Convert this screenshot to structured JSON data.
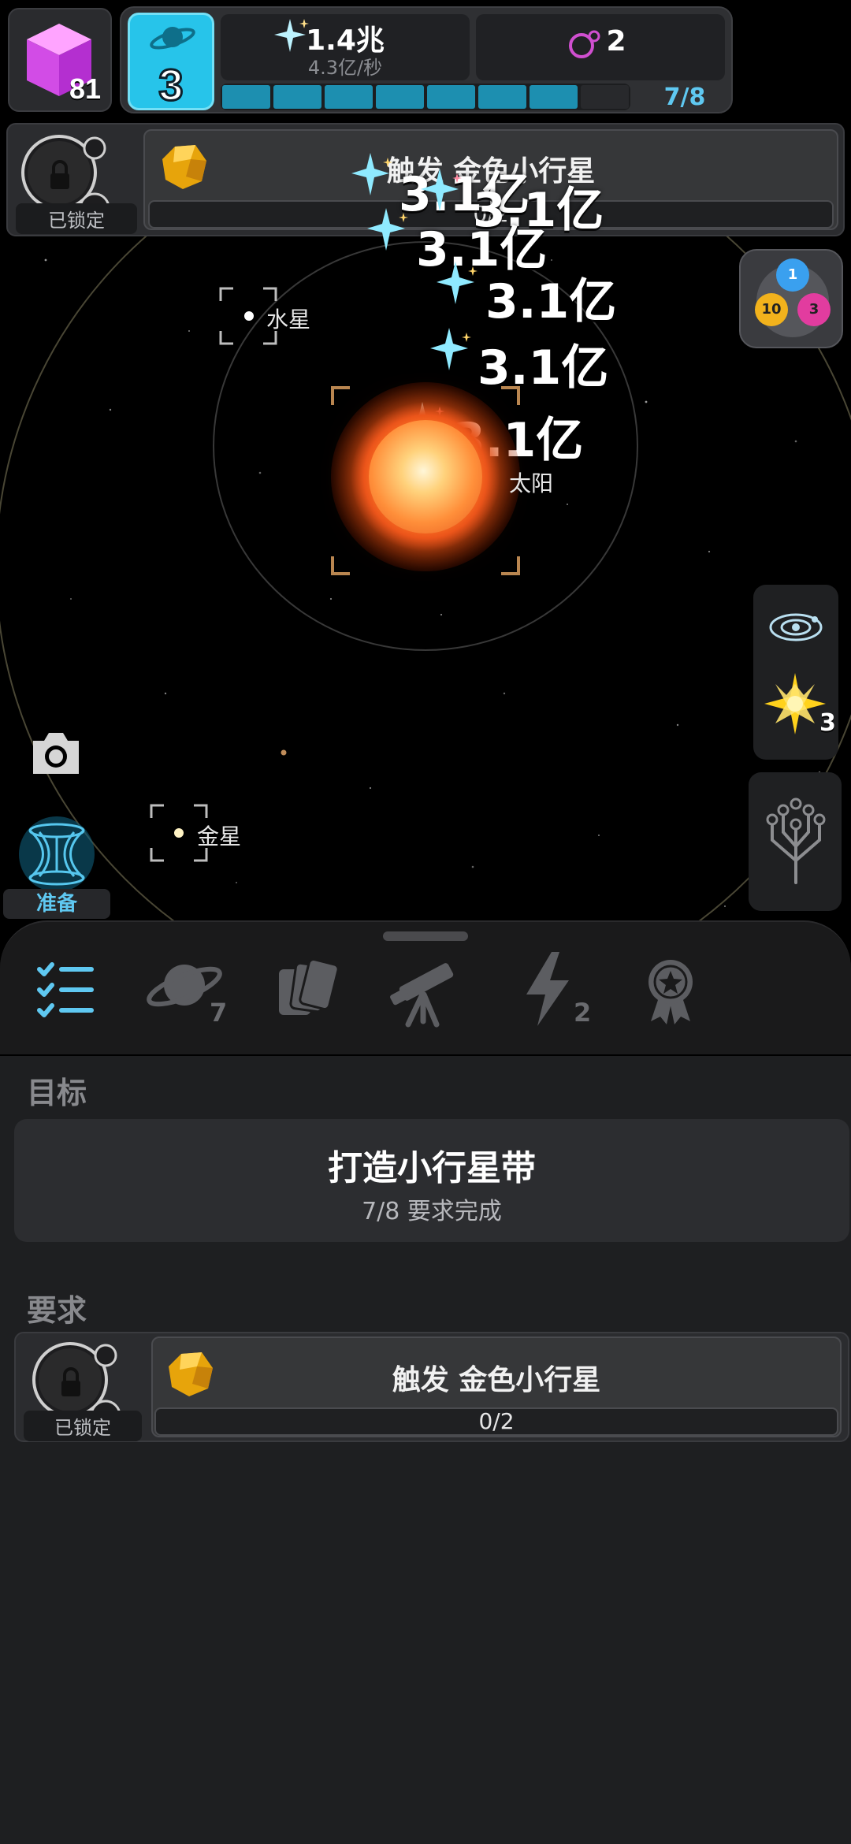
{
  "hud": {
    "cube_count": "81",
    "planet_level": "3",
    "energy_value": "1.4兆",
    "energy_rate": "4.3亿/秒",
    "moon_count": "2",
    "progress_label": "7/8",
    "progress_filled": 7,
    "progress_total": 8
  },
  "trigger_banner": {
    "lock_label": "已锁定",
    "title": "触发 金色小行星",
    "progress": "0/2"
  },
  "floating_numbers": [
    "3.1亿",
    "3.1亿",
    "3.1亿",
    "3.1亿",
    "3.1亿",
    "3.1亿"
  ],
  "planets": {
    "mercury": "水星",
    "sun": "太阳",
    "venus": "金星"
  },
  "resource_orbs": {
    "blue": "1",
    "yellow": "10",
    "pink": "3"
  },
  "side_tools": {
    "star_count": "3"
  },
  "wormhole": {
    "label": "准备"
  },
  "nav": {
    "planets_badge": "7",
    "energy_badge": "2"
  },
  "goal": {
    "section_title": "目标",
    "title": "打造小行星带",
    "subtitle": "7/8 要求完成"
  },
  "requirements": {
    "section_title": "要求",
    "lock_label": "已锁定",
    "title": "触发 金色小行星",
    "progress": "0/2"
  },
  "colors": {
    "accent_cyan": "#27c4ea",
    "progress_blue": "#1d8fb0",
    "panel_bg": "#1e1f21",
    "space_bg": "#000000",
    "label_blue": "#5fc8f1"
  }
}
